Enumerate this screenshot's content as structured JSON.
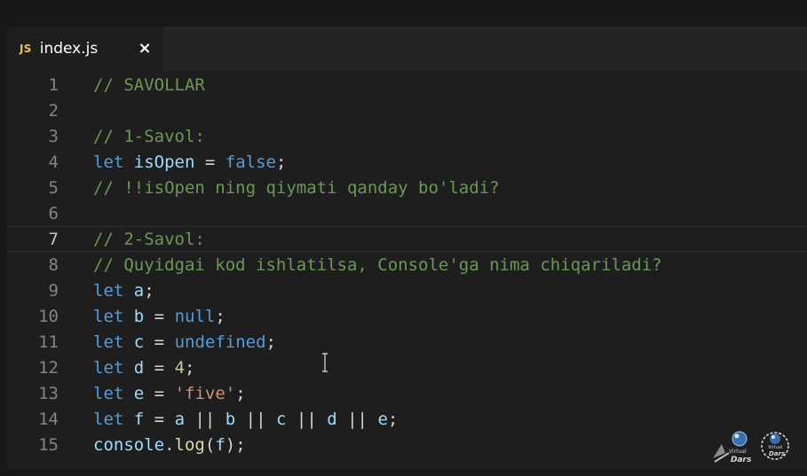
{
  "tab": {
    "icon_text": "JS",
    "filename": "index.js",
    "close_glyph": "×"
  },
  "code_lines": [
    {
      "number": "1",
      "tokens": [
        {
          "t": "// SAVOLLAR",
          "c": "comment"
        }
      ]
    },
    {
      "number": "2",
      "tokens": []
    },
    {
      "number": "3",
      "tokens": [
        {
          "t": "// 1-Savol:",
          "c": "comment"
        }
      ]
    },
    {
      "number": "4",
      "tokens": [
        {
          "t": "let",
          "c": "keyword"
        },
        {
          "t": " ",
          "c": "op"
        },
        {
          "t": "isOpen",
          "c": "var"
        },
        {
          "t": " = ",
          "c": "op"
        },
        {
          "t": "false",
          "c": "keyword"
        },
        {
          "t": ";",
          "c": "punct"
        }
      ]
    },
    {
      "number": "5",
      "tokens": [
        {
          "t": "// !!isOpen ning qiymati qanday bo'ladi?",
          "c": "comment"
        }
      ]
    },
    {
      "number": "6",
      "tokens": []
    },
    {
      "number": "7",
      "current": true,
      "tokens": [
        {
          "t": "// 2-Savol:",
          "c": "comment"
        }
      ]
    },
    {
      "number": "8",
      "tokens": [
        {
          "t": "// Quyidgai kod ishlatilsa, Console'ga nima chiqariladi?",
          "c": "comment"
        }
      ]
    },
    {
      "number": "9",
      "tokens": [
        {
          "t": "let",
          "c": "keyword"
        },
        {
          "t": " ",
          "c": "op"
        },
        {
          "t": "a",
          "c": "var"
        },
        {
          "t": ";",
          "c": "punct"
        }
      ]
    },
    {
      "number": "10",
      "tokens": [
        {
          "t": "let",
          "c": "keyword"
        },
        {
          "t": " ",
          "c": "op"
        },
        {
          "t": "b",
          "c": "var"
        },
        {
          "t": " = ",
          "c": "op"
        },
        {
          "t": "null",
          "c": "keyword"
        },
        {
          "t": ";",
          "c": "punct"
        }
      ]
    },
    {
      "number": "11",
      "tokens": [
        {
          "t": "let",
          "c": "keyword"
        },
        {
          "t": " ",
          "c": "op"
        },
        {
          "t": "c",
          "c": "var"
        },
        {
          "t": " = ",
          "c": "op"
        },
        {
          "t": "undefined",
          "c": "keyword"
        },
        {
          "t": ";",
          "c": "punct"
        }
      ]
    },
    {
      "number": "12",
      "tokens": [
        {
          "t": "let",
          "c": "keyword"
        },
        {
          "t": " ",
          "c": "op"
        },
        {
          "t": "d",
          "c": "var"
        },
        {
          "t": " = ",
          "c": "op"
        },
        {
          "t": "4",
          "c": "number"
        },
        {
          "t": ";",
          "c": "punct"
        }
      ]
    },
    {
      "number": "13",
      "tokens": [
        {
          "t": "let",
          "c": "keyword"
        },
        {
          "t": " ",
          "c": "op"
        },
        {
          "t": "e",
          "c": "var"
        },
        {
          "t": " = ",
          "c": "op"
        },
        {
          "t": "'five'",
          "c": "string"
        },
        {
          "t": ";",
          "c": "punct"
        }
      ]
    },
    {
      "number": "14",
      "tokens": [
        {
          "t": "let",
          "c": "keyword"
        },
        {
          "t": " ",
          "c": "op"
        },
        {
          "t": "f",
          "c": "var"
        },
        {
          "t": " = ",
          "c": "op"
        },
        {
          "t": "a",
          "c": "var"
        },
        {
          "t": " || ",
          "c": "op"
        },
        {
          "t": "b",
          "c": "var"
        },
        {
          "t": " || ",
          "c": "op"
        },
        {
          "t": "c",
          "c": "var"
        },
        {
          "t": " || ",
          "c": "op"
        },
        {
          "t": "d",
          "c": "var"
        },
        {
          "t": " || ",
          "c": "op"
        },
        {
          "t": "e",
          "c": "var"
        },
        {
          "t": ";",
          "c": "punct"
        }
      ]
    },
    {
      "number": "15",
      "tokens": [
        {
          "t": "console",
          "c": "var"
        },
        {
          "t": ".",
          "c": "punct"
        },
        {
          "t": "log",
          "c": "func"
        },
        {
          "t": "(",
          "c": "punct"
        },
        {
          "t": "f",
          "c": "var"
        },
        {
          "t": ");",
          "c": "punct"
        }
      ]
    }
  ],
  "watermark": {
    "logo_text_1": "Virtual",
    "logo_text_2": "Dars"
  },
  "colors": {
    "comment": "#6a9955",
    "keyword": "#569cd6",
    "variable": "#9cdcfe",
    "string": "#ce9178",
    "number": "#b5cea8",
    "function": "#dcdcaa",
    "tab_icon": "#e8c15a"
  }
}
